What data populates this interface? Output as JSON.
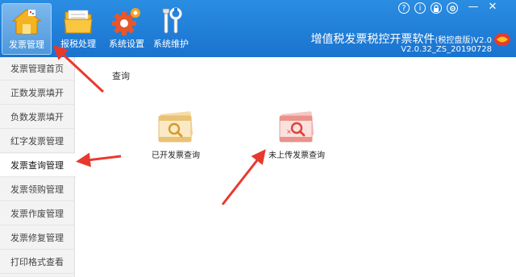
{
  "header": {
    "tools": [
      {
        "label": "发票管理",
        "icon": "house-icon"
      },
      {
        "label": "报税处理",
        "icon": "folder-icon"
      },
      {
        "label": "系统设置",
        "icon": "gear-icon"
      },
      {
        "label": "系统维护",
        "icon": "tools-icon"
      }
    ],
    "title_main": "增值税发票税控开票软件",
    "title_suffix": "(税控盘版)",
    "title_ver": "V2.0",
    "version": "V2.0.32_ZS_20190728"
  },
  "sidebar": {
    "items": [
      {
        "label": "发票管理首页"
      },
      {
        "label": "正数发票填开"
      },
      {
        "label": "负数发票填开"
      },
      {
        "label": "红字发票管理"
      },
      {
        "label": "发票查询管理"
      },
      {
        "label": "发票领购管理"
      },
      {
        "label": "发票作废管理"
      },
      {
        "label": "发票修复管理"
      },
      {
        "label": "打印格式查看"
      }
    ],
    "active_index": 4
  },
  "main": {
    "breadcrumb": "查询",
    "functions": [
      {
        "label": "已开发票查询",
        "icon": "invoice-search-icon"
      },
      {
        "label": "未上传发票查询",
        "icon": "invoice-unuploaded-search-icon"
      }
    ]
  },
  "colors": {
    "header_bg": "#1f7fd8",
    "annotation_arrow": "#e8392e",
    "sidebar_bg": "#f3f3f3"
  }
}
